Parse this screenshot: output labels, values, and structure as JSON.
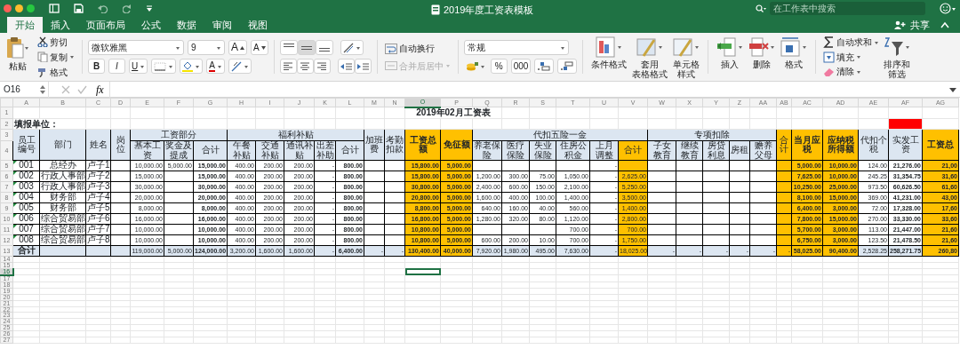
{
  "title_bar": {
    "title": "2019年度工资表模板",
    "search_placeholder": "在工作表中搜索"
  },
  "tabs": [
    {
      "label": "开始",
      "selected": true
    },
    {
      "label": "插入",
      "selected": false
    },
    {
      "label": "页面布局",
      "selected": false
    },
    {
      "label": "公式",
      "selected": false
    },
    {
      "label": "数据",
      "selected": false
    },
    {
      "label": "审阅",
      "selected": false
    },
    {
      "label": "视图",
      "selected": false
    }
  ],
  "share_label": "共享",
  "ribbon": {
    "paste": "粘贴",
    "clipboard_items": [
      {
        "kind": "cut",
        "label": "剪切"
      },
      {
        "kind": "copy",
        "label": "复制"
      },
      {
        "kind": "painter",
        "label": "格式"
      }
    ],
    "font_name": "微软雅黑",
    "font_size": "9",
    "size_buttons": [
      "A",
      "A"
    ],
    "style_buttons": [
      "B",
      "I",
      "U"
    ],
    "font_color_letter": "A",
    "wrap_text": "自动换行",
    "merge_center": {
      "label": "合并后居中",
      "disabled": true
    },
    "number_format": "常规",
    "percent": "%",
    "thousands": "000",
    "styles": [
      {
        "kind": "conditional",
        "lines": [
          "条件格式"
        ]
      },
      {
        "kind": "table",
        "lines": [
          "套用",
          "表格格式"
        ]
      },
      {
        "kind": "cell",
        "lines": [
          "单元格",
          "样式"
        ]
      }
    ],
    "cells": [
      {
        "kind": "insert",
        "label": "插入"
      },
      {
        "kind": "delete",
        "label": "删除"
      },
      {
        "kind": "format",
        "label": "格式"
      }
    ],
    "editing": [
      {
        "kind": "sum",
        "label": "自动求和"
      },
      {
        "kind": "fill",
        "label": "填充"
      },
      {
        "kind": "clear",
        "label": "清除"
      }
    ],
    "sort_filter": [
      "排序和",
      "筛选"
    ]
  },
  "formula_bar": {
    "name_box": "O16",
    "function_label": "fx"
  },
  "sheet": {
    "title": "2019年02月工资表",
    "unit_label": "填报单位：",
    "columns": [
      {
        "letter": "A",
        "selected": false,
        "kind": "normal",
        "flagged": false
      },
      {
        "letter": "B",
        "selected": false,
        "kind": "normal",
        "flagged": false
      },
      {
        "letter": "C",
        "selected": false,
        "kind": "normal",
        "flagged": false
      },
      {
        "letter": "D",
        "selected": false,
        "kind": "normal",
        "flagged": false
      },
      {
        "letter": "E",
        "selected": false,
        "kind": "normal",
        "flagged": false
      },
      {
        "letter": "F",
        "selected": false,
        "kind": "normal",
        "flagged": false
      },
      {
        "letter": "G",
        "selected": false,
        "kind": "bold",
        "flagged": false
      },
      {
        "letter": "H",
        "selected": false,
        "kind": "normal",
        "flagged": false
      },
      {
        "letter": "I",
        "selected": false,
        "kind": "normal",
        "flagged": false
      },
      {
        "letter": "J",
        "selected": false,
        "kind": "normal",
        "flagged": false
      },
      {
        "letter": "K",
        "selected": false,
        "kind": "normal",
        "flagged": false
      },
      {
        "letter": "L",
        "selected": false,
        "kind": "bold",
        "flagged": false
      },
      {
        "letter": "M",
        "selected": false,
        "kind": "normal",
        "flagged": false
      },
      {
        "letter": "N",
        "selected": false,
        "kind": "normal",
        "flagged": false
      },
      {
        "letter": "O",
        "selected": true,
        "kind": "accent_bold",
        "flagged": false
      },
      {
        "letter": "P",
        "selected": false,
        "kind": "accent_bold",
        "flagged": false
      },
      {
        "letter": "Q",
        "selected": false,
        "kind": "normal",
        "flagged": false
      },
      {
        "letter": "R",
        "selected": false,
        "kind": "normal",
        "flagged": false
      },
      {
        "letter": "S",
        "selected": false,
        "kind": "normal",
        "flagged": false
      },
      {
        "letter": "T",
        "selected": false,
        "kind": "normal",
        "flagged": false
      },
      {
        "letter": "U",
        "selected": false,
        "kind": "normal",
        "flagged": false
      },
      {
        "letter": "V",
        "selected": false,
        "kind": "accent",
        "flagged": false
      },
      {
        "letter": "W",
        "selected": false,
        "kind": "normal",
        "flagged": false
      },
      {
        "letter": "X",
        "selected": false,
        "kind": "normal",
        "flagged": false
      },
      {
        "letter": "Y",
        "selected": false,
        "kind": "normal",
        "flagged": false
      },
      {
        "letter": "Z",
        "selected": false,
        "kind": "normal",
        "flagged": false
      },
      {
        "letter": "AA",
        "selected": false,
        "kind": "normal",
        "flagged": false
      },
      {
        "letter": "AB",
        "selected": false,
        "kind": "accent",
        "flagged": false
      },
      {
        "letter": "AC",
        "selected": false,
        "kind": "accent_bold",
        "flagged": false
      },
      {
        "letter": "AD",
        "selected": false,
        "kind": "accent_bold",
        "flagged": false
      },
      {
        "letter": "AE",
        "selected": false,
        "kind": "normal",
        "flagged": false
      },
      {
        "letter": "AF",
        "selected": false,
        "kind": "bold",
        "flagged": true
      },
      {
        "letter": "AG",
        "selected": false,
        "kind": "accent_bold",
        "flagged": false
      }
    ],
    "row_numbers": [
      {
        "number": "1",
        "selected": false
      },
      {
        "number": "2",
        "selected": false
      },
      {
        "number": "3",
        "selected": false
      },
      {
        "number": "4",
        "selected": false
      },
      {
        "number": "5",
        "selected": false
      },
      {
        "number": "6",
        "selected": false
      },
      {
        "number": "7",
        "selected": false
      },
      {
        "number": "8",
        "selected": false
      },
      {
        "number": "9",
        "selected": false
      },
      {
        "number": "10",
        "selected": false
      },
      {
        "number": "11",
        "selected": false
      },
      {
        "number": "12",
        "selected": false
      },
      {
        "number": "13",
        "selected": false
      },
      {
        "number": "14",
        "selected": false
      },
      {
        "number": "15",
        "selected": false
      },
      {
        "number": "16",
        "selected": true
      },
      {
        "number": "17",
        "selected": false
      },
      {
        "number": "18",
        "selected": false
      },
      {
        "number": "19",
        "selected": false
      },
      {
        "number": "20",
        "selected": false
      },
      {
        "number": "21",
        "selected": false
      },
      {
        "number": "22",
        "selected": false
      },
      {
        "number": "23",
        "selected": false
      },
      {
        "number": "24",
        "selected": false
      },
      {
        "number": "25",
        "selected": false
      },
      {
        "number": "26",
        "selected": false
      },
      {
        "number": "27",
        "selected": false
      }
    ],
    "header": [
      {
        "text": "员工编号",
        "color": "#dce6f1"
      },
      {
        "text": "部门",
        "color": "#dce6f1"
      },
      {
        "text": "姓名",
        "color": "#dce6f1"
      },
      {
        "text": "岗位",
        "color": "#dce6f1"
      },
      {
        "text": "工资部分",
        "color": "#dce6f1",
        "children": [
          {
            "text": "基本工资",
            "color": "#dce6f1"
          },
          {
            "text": "奖金及提成",
            "color": "#dce6f1"
          },
          {
            "text": "合计",
            "color": "#dce6f1"
          }
        ]
      },
      {
        "text": "福利补贴",
        "color": "#dce6f1",
        "children": [
          {
            "text": "午餐补贴",
            "color": "#dce6f1"
          },
          {
            "text": "交通补贴",
            "color": "#dce6f1"
          },
          {
            "text": "通讯补贴",
            "color": "#dce6f1"
          },
          {
            "text": "出差补助",
            "color": "#dce6f1"
          },
          {
            "text": "合计",
            "color": "#dce6f1"
          }
        ]
      },
      {
        "text": "加班费",
        "color": "#dce6f1"
      },
      {
        "text": "考勤扣款",
        "color": "#dce6f1"
      },
      {
        "text": "工资总额",
        "color": "#ffc000"
      },
      {
        "text": "免征额",
        "color": "#ffc000"
      },
      {
        "text": "代扣五险一金",
        "color": "#dce6f1",
        "children": [
          {
            "text": "养老保险",
            "color": "#dce6f1"
          },
          {
            "text": "医疗保险",
            "color": "#dce6f1"
          },
          {
            "text": "失业保险",
            "color": "#dce6f1"
          },
          {
            "text": "住房公积金",
            "color": "#dce6f1"
          },
          {
            "text": "上月调整",
            "color": "#dce6f1"
          },
          {
            "text": "合计",
            "color": "#ffc000"
          }
        ]
      },
      {
        "text": "专项扣除",
        "color": "#dce6f1",
        "children": [
          {
            "text": "子女教育",
            "color": "#dce6f1"
          },
          {
            "text": "继续教育",
            "color": "#dce6f1"
          },
          {
            "text": "房贷利息",
            "color": "#dce6f1"
          },
          {
            "text": "房租",
            "color": "#dce6f1"
          },
          {
            "text": "赡养父母",
            "color": "#dce6f1"
          }
        ]
      },
      {
        "text": "合计",
        "color": "#ffc000"
      },
      {
        "text": "当月应税",
        "color": "#ffc000"
      },
      {
        "text": "应纳税所得额",
        "color": "#ffc000"
      },
      {
        "text": "代扣个税",
        "color": "#dce6f1"
      },
      {
        "text": "实发工资",
        "color": "#dce6f1"
      },
      {
        "text": "工资总",
        "color": "#ffc000"
      }
    ],
    "rows": [
      {
        "kind": "data",
        "marked": true,
        "cells": [
          "001",
          "总经办",
          "卢子1",
          null,
          "10,000.00",
          "5,000.00",
          "15,000.00",
          "400.00",
          "200.00",
          "200.00",
          "-",
          "800.00",
          null,
          null,
          "15,800.00",
          "5,000.00",
          null,
          null,
          null,
          null,
          "-",
          null,
          null,
          null,
          null,
          null,
          null,
          null,
          "5,000.00",
          "10,000.00",
          "124.00",
          "21,276.00",
          "21,00"
        ]
      },
      {
        "kind": "data",
        "marked": true,
        "cells": [
          "002",
          "行政人事部",
          "卢子2",
          null,
          "15,000.00",
          null,
          "15,000.00",
          "400.00",
          "200.00",
          "200.00",
          "-",
          "800.00",
          null,
          null,
          "15,800.00",
          "5,000.00",
          "1,200.00",
          "300.00",
          "75.00",
          "1,050.00",
          "-",
          "2,625.00",
          null,
          null,
          null,
          null,
          null,
          null,
          "7,625.00",
          "10,000.00",
          "245.25",
          "31,354.75",
          "31,60"
        ]
      },
      {
        "kind": "data",
        "marked": true,
        "cells": [
          "003",
          "行政人事部",
          "卢子3",
          null,
          "30,000.00",
          null,
          "30,000.00",
          "400.00",
          "200.00",
          "200.00",
          "-",
          "800.00",
          null,
          null,
          "30,800.00",
          "5,000.00",
          "2,400.00",
          "600.00",
          "150.00",
          "2,100.00",
          "-",
          "5,250.00",
          null,
          null,
          null,
          null,
          null,
          null,
          "10,250.00",
          "25,000.00",
          "973.50",
          "60,626.50",
          "61,60"
        ]
      },
      {
        "kind": "data",
        "marked": true,
        "cells": [
          "004",
          "财务部",
          "卢子4",
          null,
          "20,000.00",
          null,
          "20,000.00",
          "400.00",
          "200.00",
          "200.00",
          "-",
          "800.00",
          null,
          null,
          "20,800.00",
          "5,000.00",
          "1,600.00",
          "400.00",
          "100.00",
          "1,400.00",
          "-",
          "3,500.00",
          null,
          null,
          null,
          null,
          null,
          null,
          "8,100.00",
          "15,000.00",
          "369.00",
          "41,231.00",
          "43,00"
        ]
      },
      {
        "kind": "data",
        "marked": true,
        "cells": [
          "005",
          "财务部",
          "卢子5",
          null,
          "8,000.00",
          null,
          "8,000.00",
          "400.00",
          "200.00",
          "200.00",
          "-",
          "800.00",
          null,
          null,
          "8,800.00",
          "5,000.00",
          "640.00",
          "160.00",
          "40.00",
          "560.00",
          "-",
          "1,400.00",
          null,
          null,
          null,
          null,
          null,
          null,
          "6,400.00",
          "3,000.00",
          "72.00",
          "17,328.00",
          "17,60"
        ]
      },
      {
        "kind": "data",
        "marked": true,
        "cells": [
          "006",
          "综合贸易部",
          "卢子6",
          null,
          "16,000.00",
          null,
          "16,000.00",
          "400.00",
          "200.00",
          "200.00",
          "-",
          "800.00",
          null,
          null,
          "16,800.00",
          "5,000.00",
          "1,280.00",
          "320.00",
          "80.00",
          "1,120.00",
          "-",
          "2,800.00",
          null,
          null,
          null,
          null,
          null,
          null,
          "7,800.00",
          "15,000.00",
          "270.00",
          "33,330.00",
          "33,60"
        ]
      },
      {
        "kind": "data",
        "marked": true,
        "cells": [
          "007",
          "综合贸易部",
          "卢子7",
          null,
          "10,000.00",
          null,
          "10,000.00",
          "400.00",
          "200.00",
          "200.00",
          "-",
          "800.00",
          null,
          null,
          "10,800.00",
          "5,000.00",
          null,
          null,
          null,
          "700.00",
          "-",
          "700.00",
          null,
          null,
          null,
          null,
          null,
          null,
          "5,700.00",
          "3,000.00",
          "113.00",
          "21,447.00",
          "21,60"
        ]
      },
      {
        "kind": "data",
        "marked": true,
        "cells": [
          "008",
          "综合贸易部",
          "卢子8",
          null,
          "10,000.00",
          null,
          "10,000.00",
          "400.00",
          "200.00",
          "200.00",
          "-",
          "800.00",
          null,
          null,
          "10,800.00",
          "5,000.00",
          "600.00",
          "200.00",
          "10.00",
          "700.00",
          "-",
          "1,750.00",
          null,
          null,
          null,
          null,
          null,
          null,
          "6,750.00",
          "3,000.00",
          "123.50",
          "21,478.50",
          "21,60"
        ]
      },
      {
        "kind": "total",
        "marked": false,
        "cells": [
          "合计",
          null,
          null,
          null,
          "119,000.00",
          "5,000.00",
          "124,000.00",
          "3,200.00",
          "1,600.00",
          "1,600.00",
          "-",
          "6,400.00",
          "-",
          "-",
          "130,400.00",
          "40,000.00",
          "7,920.00",
          "1,980.00",
          "495.00",
          "7,630.00",
          "-",
          "18,025.00",
          "-",
          "-",
          "-",
          "-",
          "-",
          "-",
          "58,025.00",
          "90,400.00",
          "2,528.25",
          "258,271.75",
          "260,80"
        ]
      }
    ]
  }
}
